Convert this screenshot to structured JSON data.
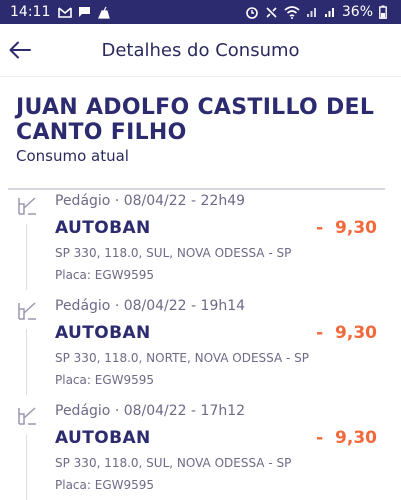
{
  "status_bar": {
    "time": "14:11",
    "battery_percent": "36%",
    "left_icons": [
      "gmail-icon",
      "message-icon",
      "cleaner-icon"
    ],
    "right_icons": [
      "alarm-icon",
      "nfc-icon",
      "wifi-icon",
      "signal-icon",
      "signal-icon",
      "battery-icon"
    ]
  },
  "header": {
    "title": "Detalhes do Consumo",
    "back_icon": "arrow-left-icon"
  },
  "customer": {
    "name": "JUAN ADOLFO CASTILLO DEL CANTO FILHO",
    "subtitle": "Consumo atual"
  },
  "colors": {
    "brand": "#2d2b6f",
    "amount": "#f26a3b",
    "muted": "#6d6b86"
  },
  "transactions": [
    {
      "meta": "Pedágio · 08/04/22 - 22h49",
      "merchant": "AUTOBAN",
      "amount": "-  9,30",
      "address": "SP 330, 118.0, SUL, NOVA ODESSA - SP",
      "plate": "Placa: EGW9595",
      "icon": "toll-icon"
    },
    {
      "meta": "Pedágio · 08/04/22 - 19h14",
      "merchant": "AUTOBAN",
      "amount": "-  9,30",
      "address": "SP 330, 118.0, NORTE, NOVA ODESSA - SP",
      "plate": "Placa: EGW9595",
      "icon": "toll-icon"
    },
    {
      "meta": "Pedágio · 08/04/22 - 17h12",
      "merchant": "AUTOBAN",
      "amount": "-  9,30",
      "address": "SP 330, 118.0, SUL, NOVA ODESSA - SP",
      "plate": "Placa: EGW9595",
      "icon": "toll-icon"
    }
  ]
}
